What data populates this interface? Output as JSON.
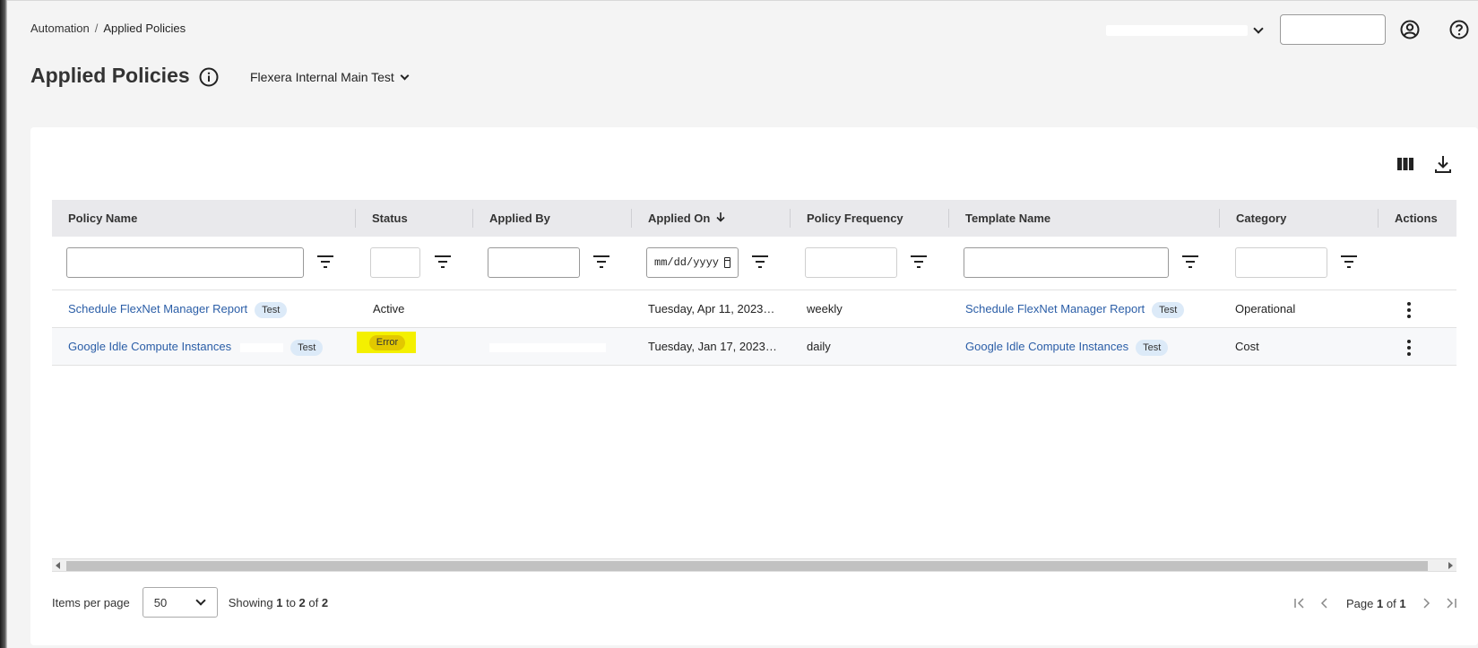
{
  "breadcrumb": {
    "parent": "Automation",
    "separator": "/",
    "current": "Applied Policies"
  },
  "header": {
    "account_value": "",
    "action_button_label": ""
  },
  "page": {
    "title": "Applied Policies",
    "org_name": "Flexera Internal Main Test"
  },
  "table": {
    "columns": [
      "Policy Name",
      "Status",
      "Applied By",
      "Applied On",
      "Policy Frequency",
      "Template Name",
      "Category",
      "Actions"
    ],
    "sorted_column": "Applied On",
    "sort_direction": "descending",
    "filters": {
      "applied_on_placeholder": "mm/dd/yyyy"
    },
    "rows": [
      {
        "policy_name": "Schedule FlexNet Manager Report",
        "policy_tag": "Test",
        "status": "Active",
        "applied_by": "",
        "applied_on": "Tuesday, Apr 11, 2023…",
        "frequency": "weekly",
        "template_name": "Schedule FlexNet Manager Report",
        "template_tag": "Test",
        "category": "Operational"
      },
      {
        "policy_name": "Google Idle Compute Instances",
        "policy_tag": "Test",
        "status": "Error",
        "applied_by": "",
        "applied_on": "Tuesday, Jan 17, 2023…",
        "frequency": "daily",
        "template_name": "Google Idle Compute Instances",
        "template_tag": "Test",
        "category": "Cost"
      }
    ]
  },
  "pagination": {
    "items_per_page_label": "Items per page",
    "items_per_page": "50",
    "showing_prefix": "Showing",
    "from": "1",
    "to_word": "to",
    "to": "2",
    "of_word": "of",
    "total": "2",
    "page_word": "Page",
    "page": "1",
    "pages": "1"
  },
  "colors": {
    "link": "#2b5ea7",
    "tag_bg": "#dceaf8",
    "error_highlight": "#f4f000",
    "header_bg": "#e9e9ec"
  },
  "icons": [
    "user-icon",
    "help-icon",
    "info-icon",
    "columns-icon",
    "download-icon",
    "filter-icon",
    "kebab-icon",
    "first-page-icon",
    "prev-page-icon",
    "next-page-icon",
    "last-page-icon"
  ]
}
